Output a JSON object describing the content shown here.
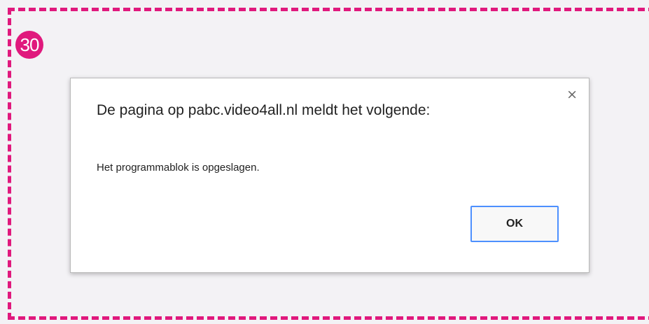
{
  "annotation": {
    "step_number": "30",
    "accent_color": "#e0197d"
  },
  "dialog": {
    "title": "De pagina op pabc.video4all.nl meldt het volgende:",
    "close_symbol": "×",
    "message": "Het programmablok is opgeslagen.",
    "ok_label": "OK",
    "focus_color": "#4d90fe"
  }
}
